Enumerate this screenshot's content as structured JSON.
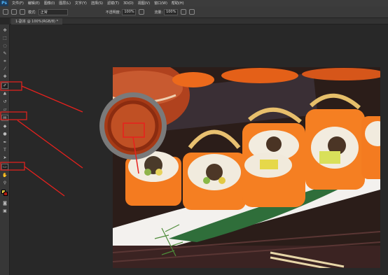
{
  "app": {
    "logo": "Ps"
  },
  "menu": {
    "items": [
      "文件(F)",
      "编辑(E)",
      "图像(I)",
      "图层(L)",
      "文字(Y)",
      "选择(S)",
      "滤镜(T)",
      "3D(D)",
      "视图(V)",
      "窗口(W)",
      "帮助(H)"
    ]
  },
  "options": {
    "mode_label": "模式:",
    "mode_value": "正常",
    "opacity_label": "不透明度:",
    "opacity_value": "100%",
    "flow_label": "流量:",
    "flow_value": "100%"
  },
  "document": {
    "tab_title": "1-副本 @ 100%(RGB/8) *"
  },
  "tools": [
    "move-icon",
    "marquee-icon",
    "lasso-icon",
    "quick-select-icon",
    "crop-icon",
    "eyedropper-icon",
    "healing-brush-icon",
    "brush-icon",
    "clone-stamp-icon",
    "history-brush-icon",
    "eraser-icon",
    "gradient-icon",
    "blur-icon",
    "dodge-icon",
    "pen-icon",
    "type-icon",
    "path-select-icon",
    "shape-icon",
    "hand-icon",
    "zoom-icon"
  ],
  "colors": {
    "accent_red": "#e8211d",
    "photo_bg": "#2a1c18",
    "salmon": "#f47b20"
  }
}
